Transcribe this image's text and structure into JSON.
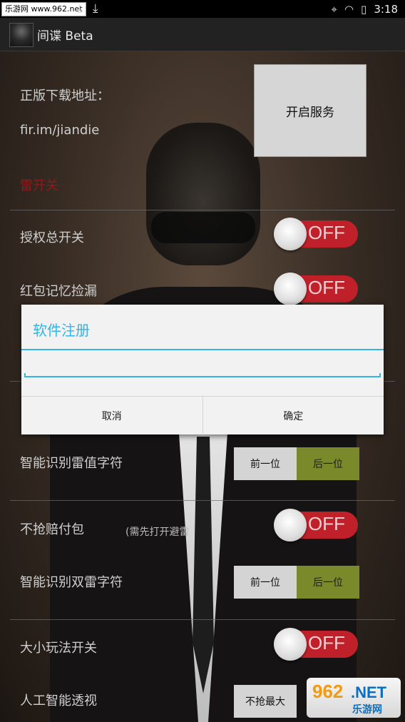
{
  "status_bar": {
    "site_badge": "乐游网 www.962.net",
    "time": "3:18"
  },
  "app_bar": {
    "title": "间谍 Beta"
  },
  "main": {
    "download_label": "正版下载地址：",
    "download_url": "fir.im/jiandie",
    "red_label": "雷开关",
    "start_service_label": "开启服务",
    "rows": {
      "auth_switch": "授权总开关",
      "redpack_memory": "红包记忆捡漏",
      "smart_thunder": "智能识别雷值字符",
      "no_grab_pay": "不抢赔付包",
      "no_grab_note": "(需先打开避雷",
      "smart_double": "智能识别双雷字符",
      "size_game": "大小玩法开关",
      "ai_view": "人工智能透视"
    },
    "toggle_off_label": "OFF",
    "seg_prev": "前一位",
    "seg_next": "后一位",
    "seg_no_max": "不抢最大"
  },
  "dialog": {
    "title": "软件注册",
    "input_value": "",
    "cancel_label": "取消",
    "confirm_label": "确定"
  },
  "watermark": {
    "brand": "962",
    "net": ".NET",
    "cn": "乐游网"
  },
  "colors": {
    "accent": "#33b5e5",
    "toggle_off": "#c0202a",
    "seg_selected": "#7a8a2a"
  }
}
